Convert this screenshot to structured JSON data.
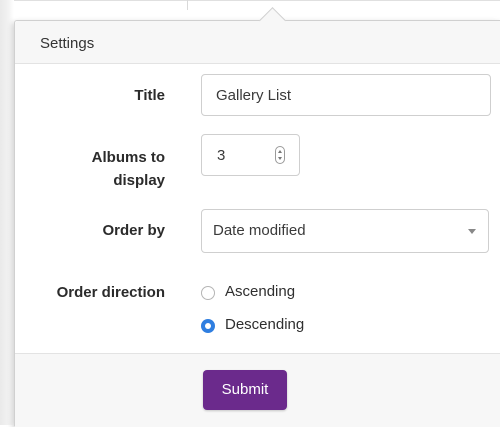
{
  "popover": {
    "title": "Settings"
  },
  "fields": {
    "title": {
      "label": "Title",
      "value": "Gallery List"
    },
    "albums": {
      "label_line1": "Albums to",
      "label_line2": "display",
      "value": "3"
    },
    "order_by": {
      "label": "Order by",
      "value": "Date modified"
    },
    "order_direction": {
      "label": "Order direction",
      "options": [
        {
          "label": "Ascending",
          "checked": false
        },
        {
          "label": "Descending",
          "checked": true
        }
      ]
    }
  },
  "footer": {
    "submit_label": "Submit"
  },
  "colors": {
    "accent": "#2f7ee0",
    "button": "#6b2a8c"
  }
}
